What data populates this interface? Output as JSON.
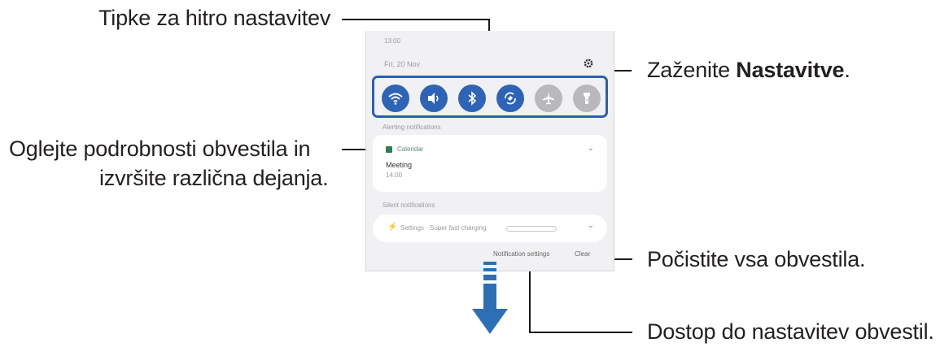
{
  "callouts": {
    "quick_buttons": "Tipke za hitro nastavitev",
    "launch_settings_prefix": "Zaženite ",
    "launch_settings_bold": "Nastavitve",
    "launch_settings_suffix": ".",
    "notification_details_line1": "Oglejte podrobnosti obvestila in",
    "notification_details_line2": "izvršite različna dejanja.",
    "clear_all": "Počistite vsa obvestila.",
    "notification_settings_access": "Dostop do nastavitev obvestil."
  },
  "panel": {
    "time": "13:00",
    "date": "Fri, 20 Nov",
    "quick_settings": [
      {
        "icon": "wifi-icon",
        "state": "on"
      },
      {
        "icon": "sound-icon",
        "state": "on"
      },
      {
        "icon": "bluetooth-icon",
        "state": "on"
      },
      {
        "icon": "auto-rotate-icon",
        "state": "on"
      },
      {
        "icon": "airplane-mode-icon",
        "state": "off"
      },
      {
        "icon": "flashlight-icon",
        "state": "off"
      }
    ],
    "ongoing_header": "Alerting notifications",
    "calendar_app": "Calendar",
    "calendar_title": "Meeting",
    "calendar_time": "14:00",
    "silent_header": "Silent notifications",
    "settings_notification": "Settings · Super fast charging",
    "notification_settings_button": "Notification settings",
    "clear_button": "Clear"
  },
  "colors": {
    "accent": "#2e64b7",
    "arrow": "#2c6fb4",
    "inactive": "#b9b9bd"
  }
}
